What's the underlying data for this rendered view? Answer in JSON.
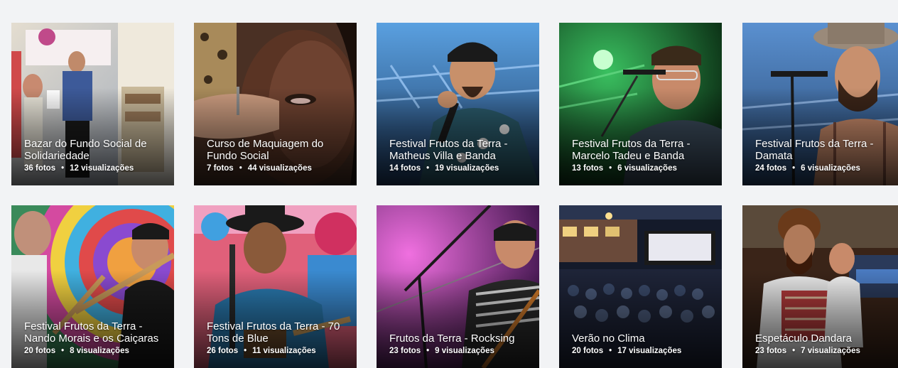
{
  "albums": [
    {
      "title": "Bazar do Fundo Social de Solidariedade",
      "photos": "36 fotos",
      "views": "12 visualizações",
      "bg": [
        "#d9d2c6",
        "#8aa0c0"
      ],
      "accent": "#3d5a99",
      "scene": "photo-scene"
    },
    {
      "title": "Curso de Maquiagem do Fundo Social",
      "photos": "7 fotos",
      "views": "44 visualizações",
      "bg": [
        "#6b4a3a",
        "#2b1a14"
      ],
      "accent": "#c9a27e",
      "scene": "photo-scene"
    },
    {
      "title": "Festival Frutos da Terra - Matheus Villa e Banda",
      "photos": "14 fotos",
      "views": "19 visualizações",
      "bg": [
        "#3a7cc4",
        "#1e3d66"
      ],
      "accent": "#5fa0d8",
      "scene": "photo-scene"
    },
    {
      "title": "Festival Frutos da Terra - Marcelo Tadeu e Banda",
      "photos": "13 fotos",
      "views": "6 visualizações",
      "bg": [
        "#1f8a3a",
        "#0e3a18"
      ],
      "accent": "#6cff8a",
      "scene": "photo-scene"
    },
    {
      "title": "Festival Frutos da Terra - Damata",
      "photos": "24 fotos",
      "views": "6 visualizações",
      "bg": [
        "#4a7fc4",
        "#26456e"
      ],
      "accent": "#c98a6a",
      "scene": "photo-scene"
    },
    {
      "title": "Festival Frutos da Terra - Nando Morais e os Caiçaras",
      "photos": "20 fotos",
      "views": "8 visualizações",
      "bg": [
        "#d44aa0",
        "#3a8a5a"
      ],
      "accent": "#f0d040",
      "scene": "photo-scene"
    },
    {
      "title": "Festival Frutos da Terra - 70 Tons de Blue",
      "photos": "26 fotos",
      "views": "11 visualizações",
      "bg": [
        "#d04a6a",
        "#2a6ab0"
      ],
      "accent": "#1a1a1a",
      "scene": "photo-scene"
    },
    {
      "title": "Frutos da Terra - Rocksing",
      "photos": "23 fotos",
      "views": "9 visualizações",
      "bg": [
        "#c44ab8",
        "#4a1a5a"
      ],
      "accent": "#e060d0",
      "scene": "photo-scene"
    },
    {
      "title": "Verão no Clima",
      "photos": "20 fotos",
      "views": "17 visualizações",
      "bg": [
        "#2a3550",
        "#0e1424"
      ],
      "accent": "#e8e8f0",
      "scene": "photo-scene"
    },
    {
      "title": "Espetáculo Dandara",
      "photos": "23 fotos",
      "views": "7 visualizações",
      "bg": [
        "#7a4a3a",
        "#2a1a14"
      ],
      "accent": "#d04a4a",
      "scene": "photo-scene"
    }
  ],
  "separator": "•"
}
